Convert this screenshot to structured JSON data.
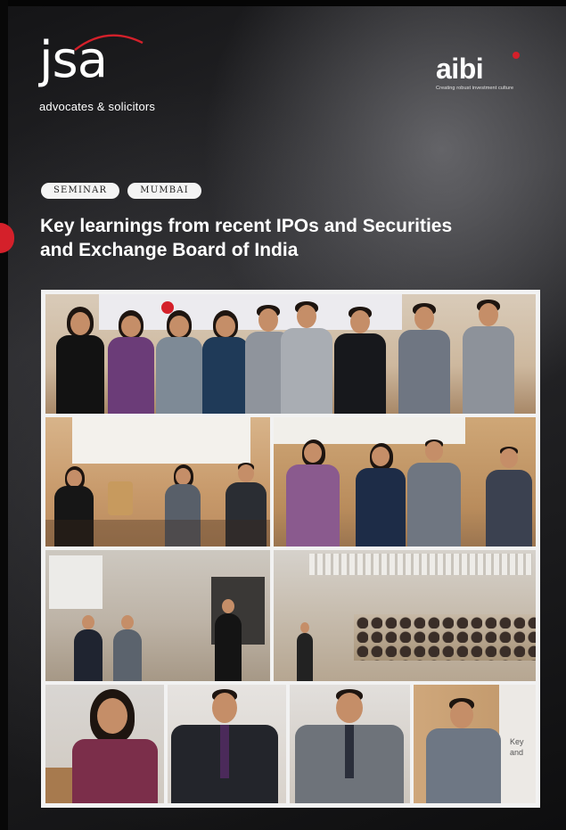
{
  "brand_left": {
    "logo_text": "jsa",
    "subtitle": "advocates & solicitors"
  },
  "brand_right": {
    "logo_text": "aibi",
    "tagline": "Creating robust investment culture"
  },
  "tags": [
    "SEMINAR",
    "MUMBAI"
  ],
  "title_line1": "Key learnings from recent IPOs and Securities",
  "title_line2": "and Exchange Board of India",
  "colors": {
    "accent_red": "#d4202a",
    "background": "#1b1b1d",
    "text": "#ffffff"
  },
  "photos": [
    {
      "name": "group-photo-speakers"
    },
    {
      "name": "panel-discussion-photo-1"
    },
    {
      "name": "panel-discussion-photo-2"
    },
    {
      "name": "stage-photo"
    },
    {
      "name": "audience-photo"
    },
    {
      "name": "speaker-photo-1"
    },
    {
      "name": "speaker-photo-2"
    },
    {
      "name": "speaker-photo-3"
    },
    {
      "name": "speaker-photo-4",
      "slide_text": "Key and"
    }
  ]
}
